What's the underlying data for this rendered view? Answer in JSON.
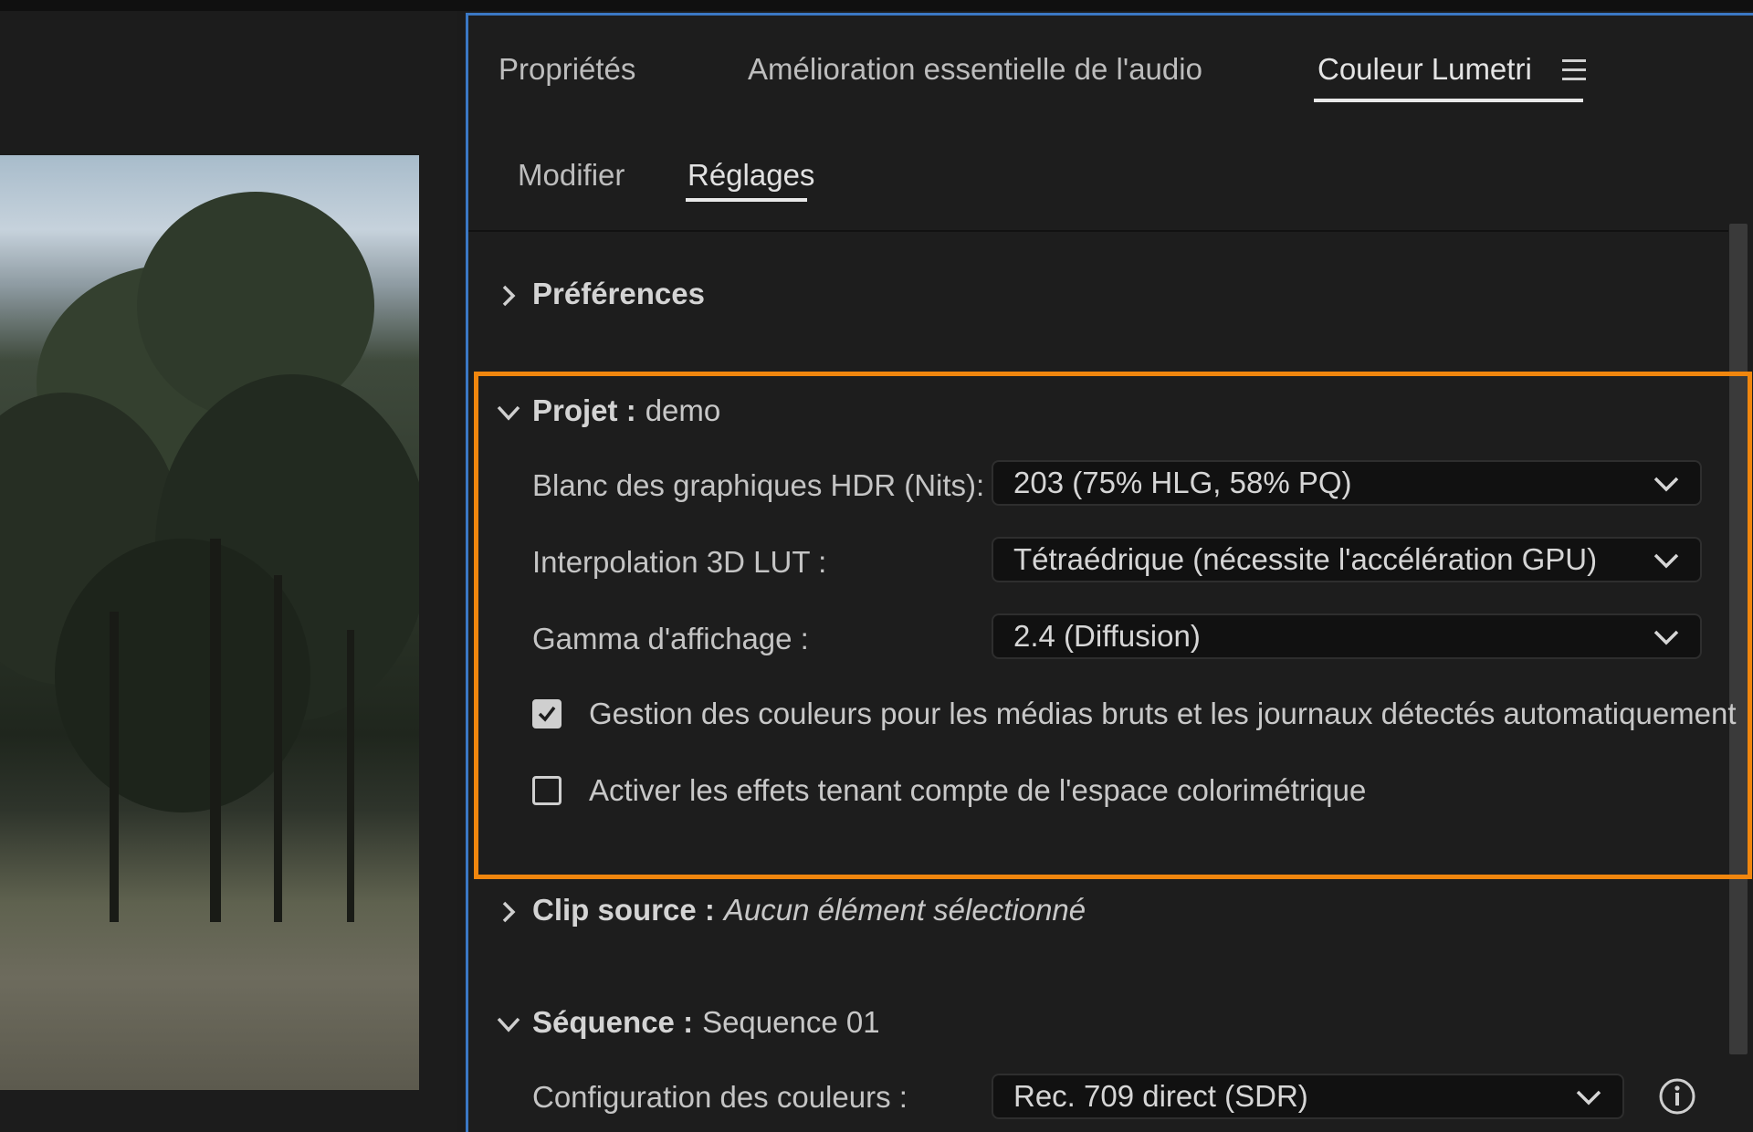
{
  "tabs": {
    "items": [
      {
        "label": "Propriétés"
      },
      {
        "label": "Amélioration essentielle de l'audio"
      },
      {
        "label": "Couleur Lumetri"
      }
    ],
    "active": "Couleur Lumetri",
    "menu_icon": "hamburger-menu-icon"
  },
  "subtabs": {
    "items": [
      {
        "label": "Modifier"
      },
      {
        "label": "Réglages"
      }
    ],
    "active": "Réglages"
  },
  "sections": {
    "preferences": {
      "title": "Préférences",
      "expanded": false
    },
    "project": {
      "title": "Projet :",
      "name": "demo",
      "expanded": true,
      "highlight_color": "#f0860e",
      "hdr_white": {
        "label": "Blanc des graphiques HDR (Nits):",
        "value": "203 (75% HLG, 58% PQ)"
      },
      "lut_interp": {
        "label": "Interpolation 3D LUT :",
        "value": "Tétraédrique (nécessite l'accélération GPU)"
      },
      "gamma": {
        "label": "Gamma d'affichage :",
        "value": "2.4 (Diffusion)"
      },
      "auto_color": {
        "label": "Gestion des couleurs pour les médias bruts et les journaux détectés automatiquement",
        "checked": true
      },
      "color_aware": {
        "label": "Activer les effets tenant compte de l'espace colorimétrique",
        "checked": false
      }
    },
    "clip_source": {
      "title": "Clip source :",
      "value": "Aucun élément sélectionné",
      "expanded": false
    },
    "sequence": {
      "title": "Séquence :",
      "name": "Sequence 01",
      "expanded": true,
      "color_config": {
        "label": "Configuration des couleurs :",
        "value": "Rec. 709 direct (SDR)"
      }
    }
  },
  "colors": {
    "panel_border": "#3b78c4",
    "highlight": "#f0860e"
  }
}
